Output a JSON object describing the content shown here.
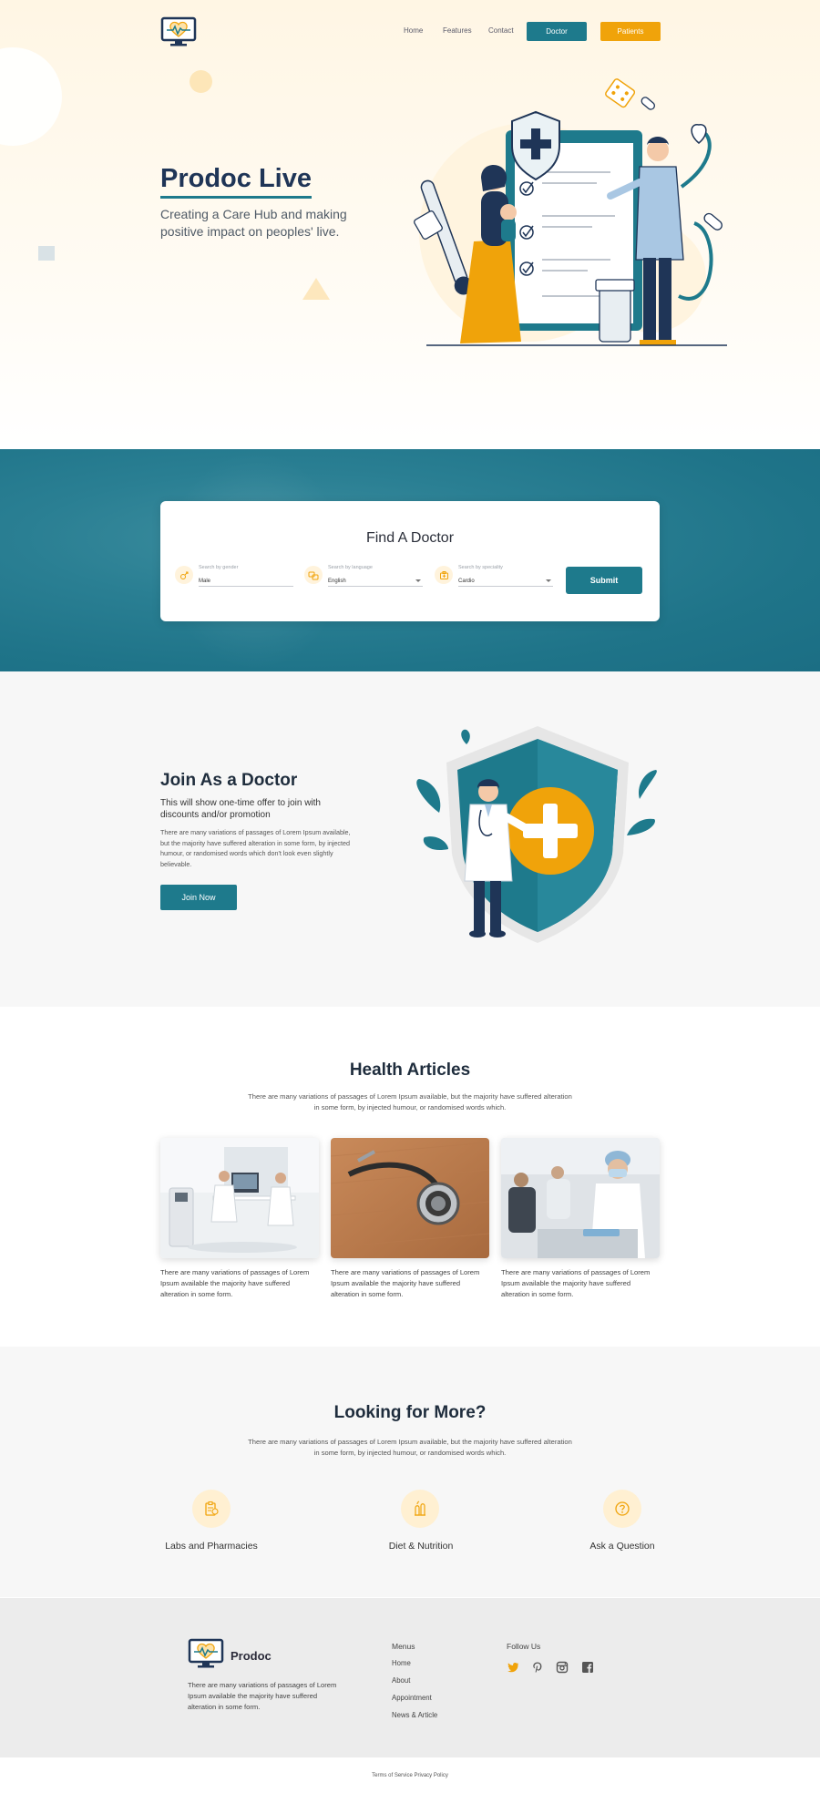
{
  "nav": {
    "links": [
      "Home",
      "Features",
      "Contact"
    ],
    "doctor_button": "Doctor",
    "patients_button": "Patients"
  },
  "hero": {
    "title": "Prodoc Live",
    "subtitle": "Creating a Care Hub and making positive impact on peoples' live."
  },
  "find_doctor": {
    "title": "Find A Doctor",
    "fields": [
      {
        "label": "Search by gender",
        "value": "Male"
      },
      {
        "label": "Search by language",
        "value": "English"
      },
      {
        "label": "Search by speciality",
        "value": "Cardio"
      }
    ],
    "submit": "Submit"
  },
  "join": {
    "title": "Join As a Doctor",
    "subtitle": "This will show one-time offer to join with discounts and/or promotion",
    "body": "There are many variations of passages of Lorem Ipsum available, but the majority have suffered alteration in some form, by injected humour, or randomised words which don't look even slightly believable.",
    "button": "Join Now"
  },
  "articles": {
    "title": "Health Articles",
    "description": "There are many variations of passages of Lorem Ipsum available, but the majority have suffered alteration in some form, by injected humour, or randomised words which.",
    "items": [
      {
        "text": "There are many variations of passages of Lorem Ipsum available the majority have suffered alteration in some form."
      },
      {
        "text": "There are many variations of passages of Lorem Ipsum available the majority have suffered alteration in some form."
      },
      {
        "text": "There are many variations of passages of Lorem Ipsum available the majority have suffered alteration in some form."
      }
    ]
  },
  "more": {
    "title": "Looking for More?",
    "description": "There are many variations of passages of Lorem Ipsum available, but the majority have suffered alteration in some form, by injected humour, or randomised words which.",
    "services": [
      {
        "label": "Labs and Pharmacies",
        "icon": "lab-icon"
      },
      {
        "label": "Diet & Nutrition",
        "icon": "nutrition-icon"
      },
      {
        "label": "Ask a Question",
        "icon": "question-icon"
      }
    ]
  },
  "footer": {
    "brand": "Prodoc",
    "description": "There are many variations of passages of Lorem Ipsum available the majority have suffered alteration in some form.",
    "menus_title": "Menus",
    "menu_links": [
      "Home",
      "About",
      "Appointment",
      "News & Article"
    ],
    "follow_title": "Follow Us",
    "social": [
      "twitter-icon",
      "pinterest-icon",
      "instagram-icon",
      "facebook-icon"
    ],
    "legal": "Terms of Service Privacy Policy"
  },
  "colors": {
    "primary": "#1e7a8c",
    "accent": "#f0a30a",
    "navy": "#1f3557"
  }
}
